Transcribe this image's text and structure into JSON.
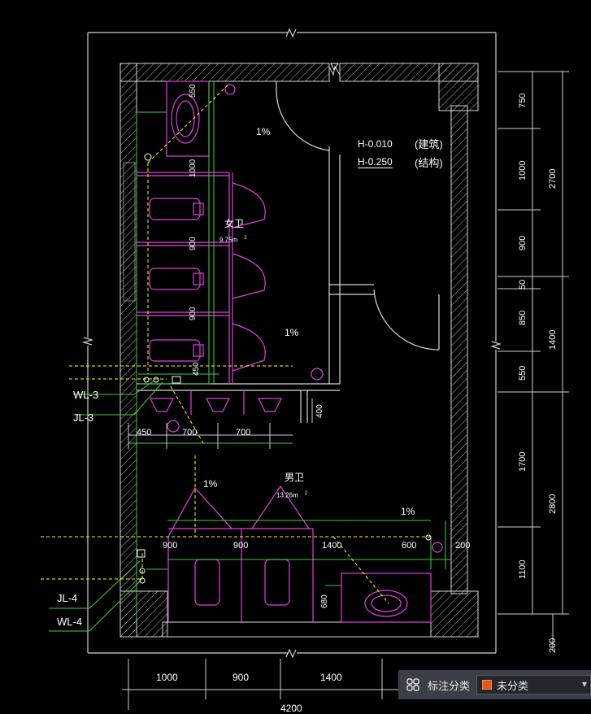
{
  "drawing": {
    "room_labels": {
      "female": "女卫",
      "female_area": "9.75m",
      "male": "男卫",
      "male_area": "13.26m",
      "area_superscript": "2"
    },
    "elevations": {
      "building": "H-0.010",
      "building_note": "(建筑)",
      "structure": "H-0.250",
      "structure_note": "(结构)"
    },
    "slope_labels": [
      "1%",
      "1%",
      "1%",
      "1%"
    ],
    "pipe_labels": {
      "wl3": "WL-3",
      "jl3": "JL-3",
      "jl4": "JL-4",
      "wl4": "WL-4"
    },
    "inner_dims": {
      "d550": "550",
      "d1000": "1000",
      "d900a": "900",
      "d900b": "900",
      "d450": "450",
      "d400": "400",
      "d450b": "450",
      "d700a": "700",
      "d700b": "700",
      "d900c": "900",
      "d900d": "900",
      "d1400": "1400",
      "d600": "600",
      "d200": "200",
      "d680": "680"
    },
    "right_dims": [
      "750",
      "1000",
      "900",
      "50",
      "850",
      "550",
      "1700",
      "1100"
    ],
    "right_totals": {
      "top": "2700",
      "middle": "1400",
      "bottom": "2800"
    },
    "right_bottom": "200",
    "bottom_dims": [
      "1000",
      "900",
      "1400"
    ],
    "bottom_total": "4200"
  },
  "toolbar": {
    "icon": "annotation-category-icon",
    "label": "标注分类",
    "selected": "未分类",
    "swatch_color": "#e8541a"
  },
  "colors": {
    "magenta": "#e040e0",
    "green": "#40d040",
    "yellow": "#ffff00",
    "white": "#ffffff",
    "red": "#ff3030"
  }
}
